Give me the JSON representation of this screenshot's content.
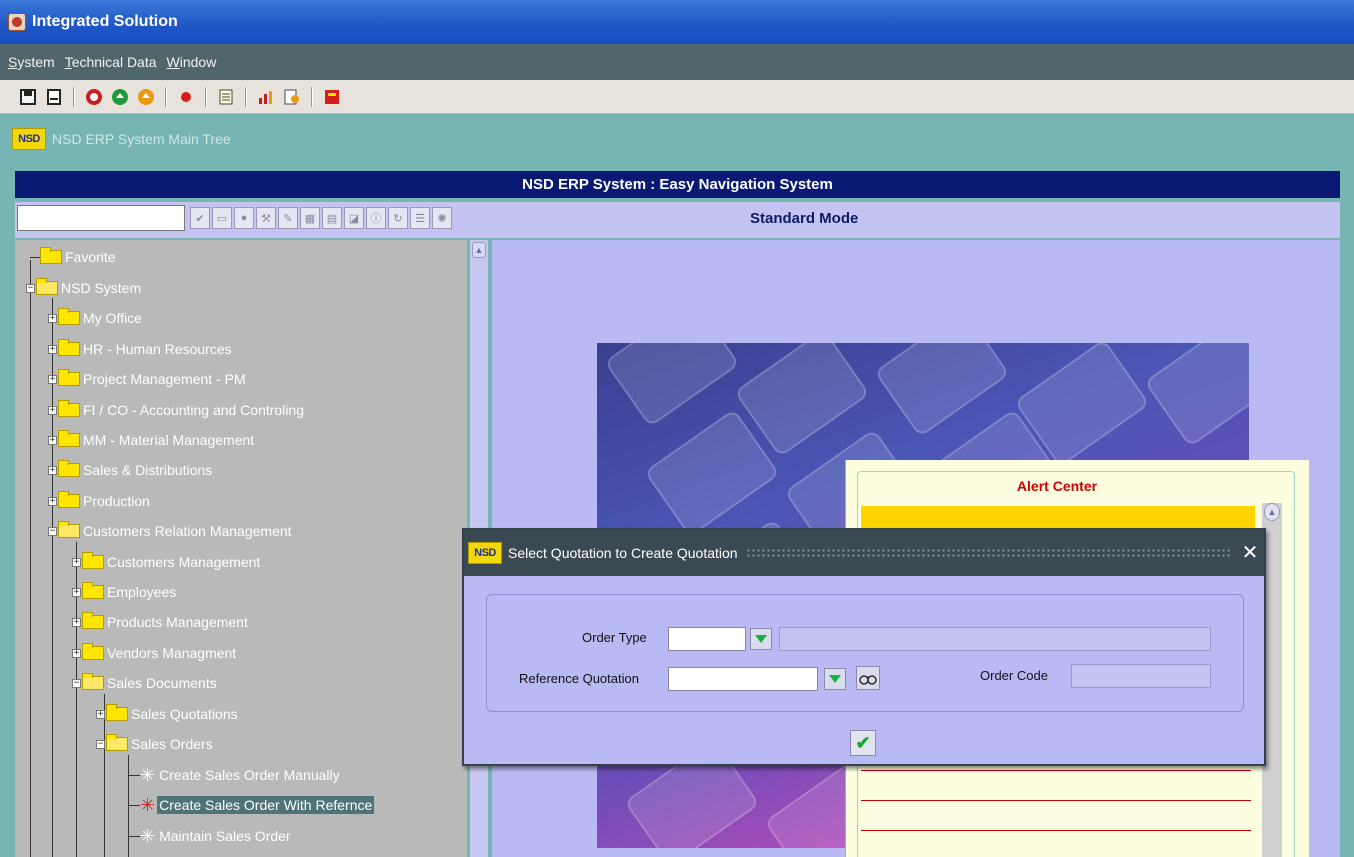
{
  "window": {
    "title": "Integrated Solution"
  },
  "menu": {
    "items": [
      "System",
      "Technical Data",
      "Window"
    ]
  },
  "header": {
    "logo_text": "NSD",
    "main_tree_title": "NSD ERP System Main Tree",
    "system_title": "NSD ERP System : Easy Navigation System",
    "mode_label": "Standard Mode"
  },
  "tree": {
    "items": [
      {
        "label": "Favorite"
      },
      {
        "label": "NSD  System"
      },
      {
        "label": "My Office"
      },
      {
        "label": "HR - Human Resources"
      },
      {
        "label": "Project Management - PM"
      },
      {
        "label": "FI / CO - Accounting and Controling"
      },
      {
        "label": "MM - Material Management"
      },
      {
        "label": "Sales & Distributions"
      },
      {
        "label": "Production"
      },
      {
        "label": "Customers Relation Management"
      },
      {
        "label": "Customers Management"
      },
      {
        "label": "Employees"
      },
      {
        "label": "Products Management"
      },
      {
        "label": "Vendors Managment"
      },
      {
        "label": "Sales Documents"
      },
      {
        "label": "Sales Quotations"
      },
      {
        "label": "Sales Orders"
      },
      {
        "label": "Create Sales Order Manually"
      },
      {
        "label": "Create Sales Order With Refernce"
      },
      {
        "label": "Maintain Sales Order"
      }
    ]
  },
  "alert_center": {
    "title": "Alert Center"
  },
  "dialog": {
    "title": "Select Quotation to Create Quotation",
    "order_type_label": "Order Type",
    "reference_quotation_label": "Reference Quotation",
    "order_code_label": "Order Code",
    "order_type_value": "",
    "order_type_desc": "",
    "reference_quotation_value": "",
    "order_code_value": ""
  }
}
